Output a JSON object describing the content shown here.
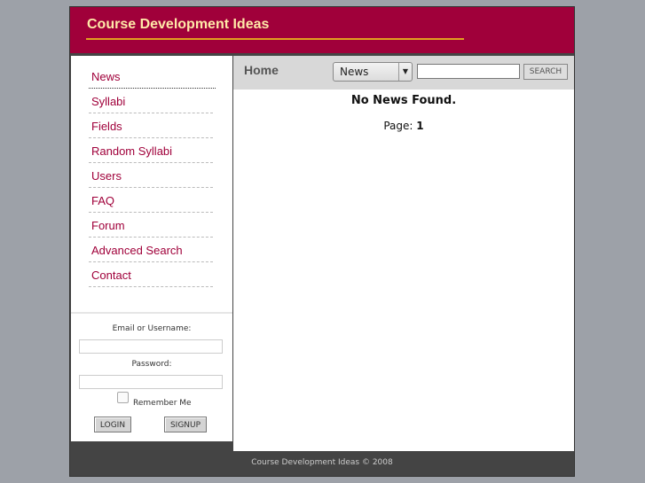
{
  "header": {
    "site_title": "Course Development Ideas"
  },
  "nav": {
    "items": [
      {
        "label": "News"
      },
      {
        "label": "Syllabi"
      },
      {
        "label": "Fields"
      },
      {
        "label": "Random Syllabi"
      },
      {
        "label": "Users"
      },
      {
        "label": "FAQ"
      },
      {
        "label": "Forum"
      },
      {
        "label": "Advanced Search"
      },
      {
        "label": "Contact"
      }
    ]
  },
  "login": {
    "email_label": "Email or Username:",
    "password_label": "Password:",
    "remember_label": "Remember Me",
    "login_button": "LOGIN",
    "signup_button": "SIGNUP",
    "email_value": "",
    "password_value": ""
  },
  "main": {
    "heading": "Home",
    "search_scope": "News",
    "search_value": "",
    "search_button": "SEARCH",
    "message": "No News Found.",
    "page_label": "Page:",
    "page_number": "1"
  },
  "footer": {
    "text": "Course Development Ideas © 2008"
  },
  "colors": {
    "brand": "#a0003a",
    "title": "#ffe9a8",
    "rule": "#e0a020",
    "footer": "#444444"
  }
}
